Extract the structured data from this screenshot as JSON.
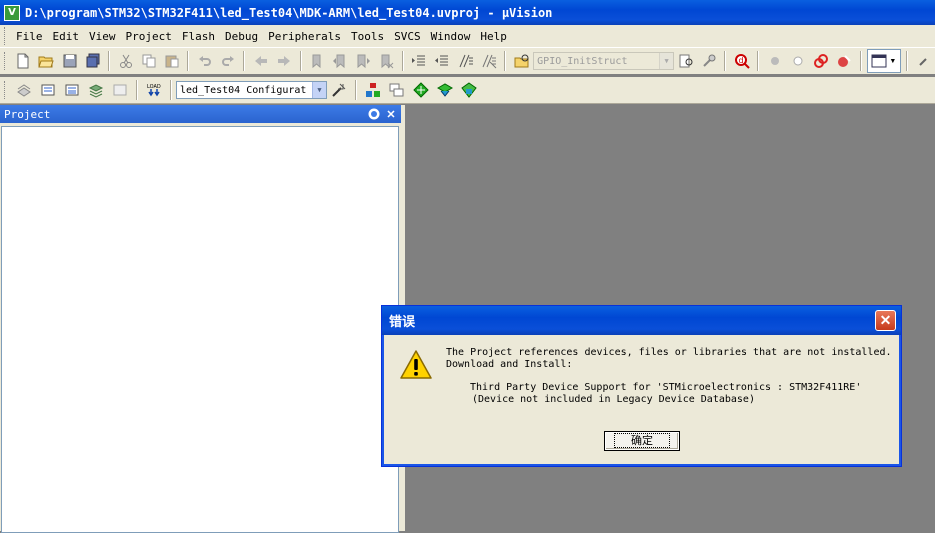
{
  "window": {
    "title": "D:\\program\\STM32\\STM32F411\\led_Test04\\MDK-ARM\\led_Test04.uvproj - µVision"
  },
  "menu": [
    "File",
    "Edit",
    "View",
    "Project",
    "Flash",
    "Debug",
    "Peripherals",
    "Tools",
    "SVCS",
    "Window",
    "Help"
  ],
  "toolbar1": {
    "find_combo": "GPIO_InitStruct"
  },
  "toolbar2": {
    "target_combo": "led_Test04 Configurat"
  },
  "project_panel": {
    "title": "Project"
  },
  "dialog": {
    "title": "错误",
    "line1": "The Project references devices, files or libraries that are not installed.",
    "line2": "Download and Install:",
    "line3": "Third Party Device Support for 'STMicroelectronics : STM32F411RE'",
    "line4": "(Device not included in Legacy Device Database)",
    "ok_label": "确定"
  },
  "colors": {
    "title_bar": "#0a5fe0",
    "workspace": "#808080",
    "chrome": "#ece9d8"
  }
}
